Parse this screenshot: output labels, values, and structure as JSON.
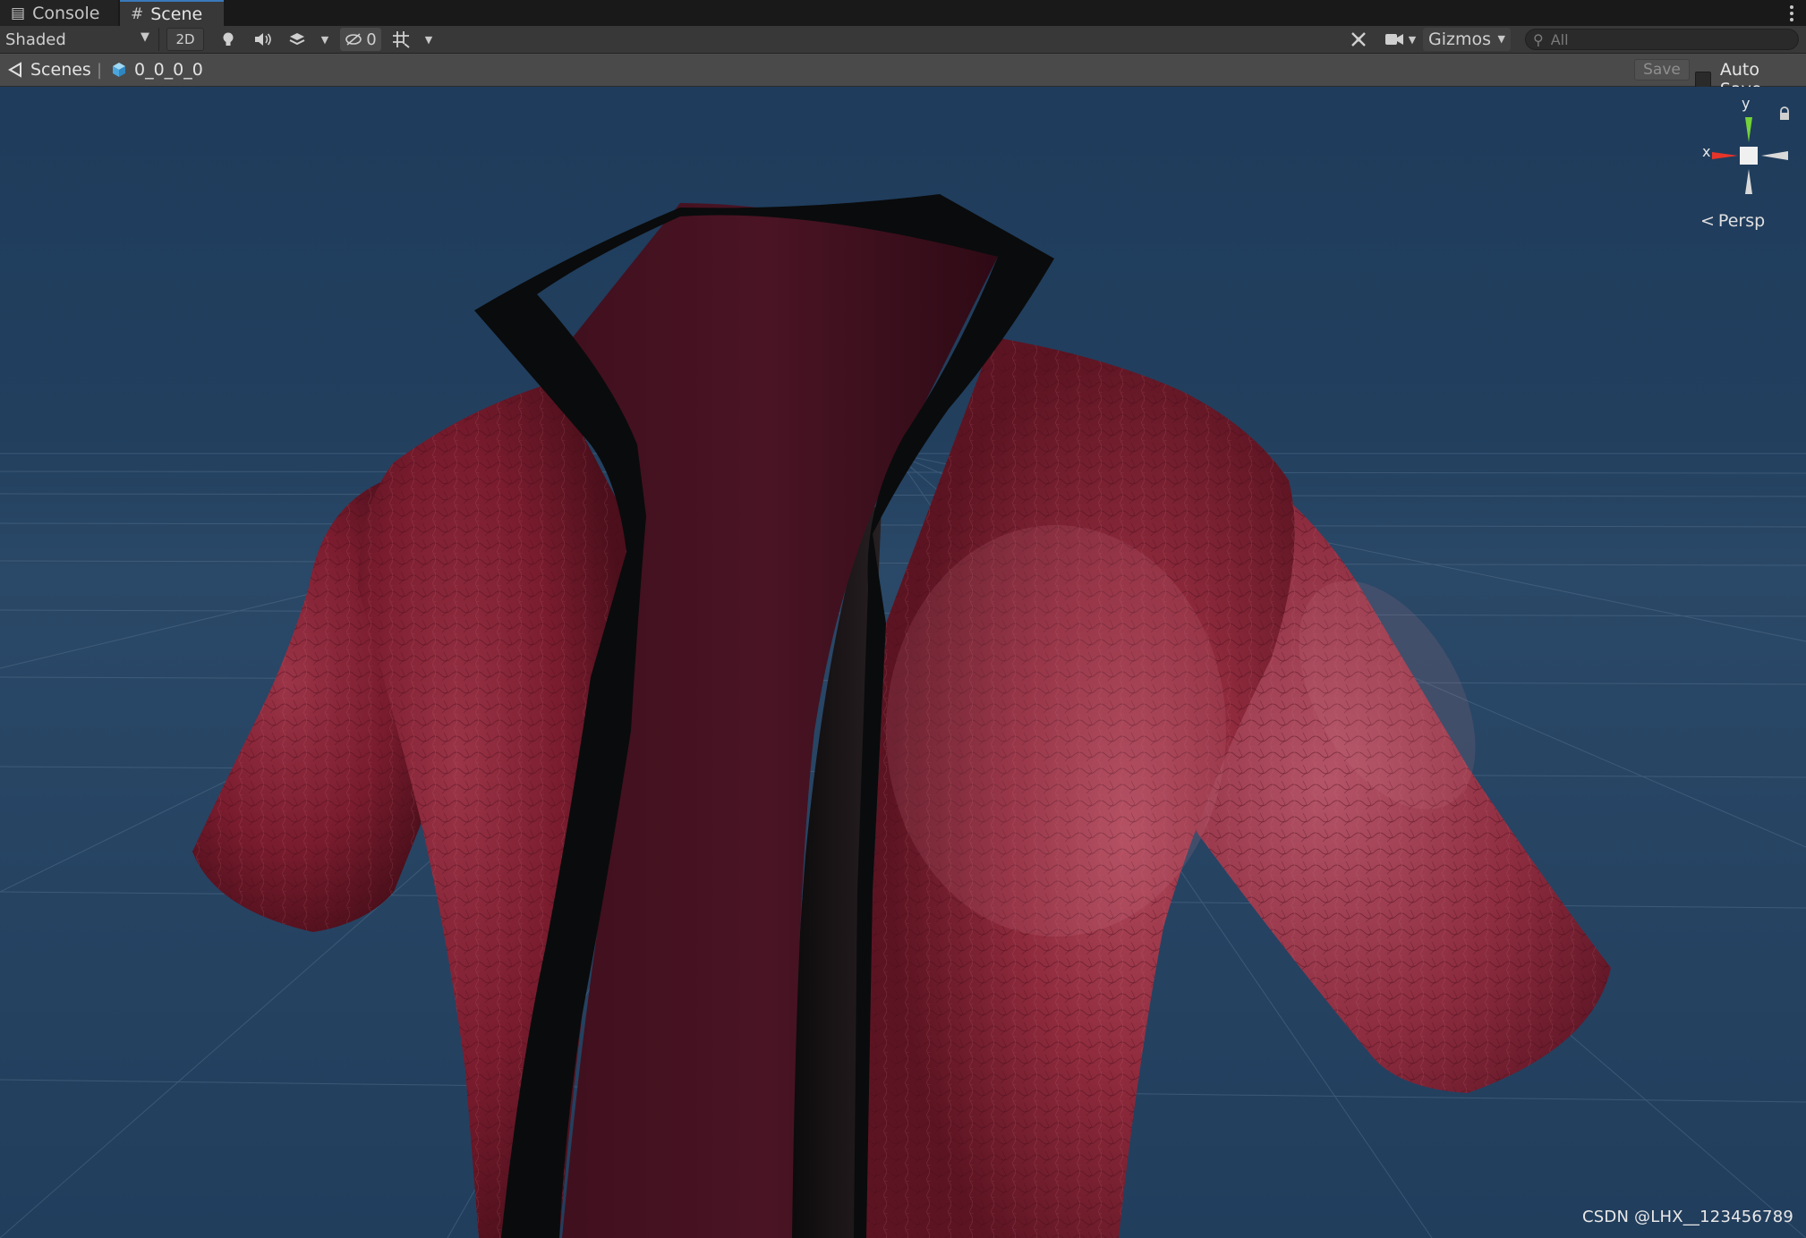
{
  "tabs": {
    "console_label": "Console",
    "scene_label": "Scene"
  },
  "toolbar": {
    "draw_mode": "Shaded",
    "mode_2d_label": "2D",
    "hidden_count": "0",
    "gizmos_label": "Gizmos",
    "search_placeholder": "All"
  },
  "breadcrumb": {
    "scenes_label": "Scenes",
    "object_name": "0_0_0_0"
  },
  "scene_actions": {
    "save_label": "Save",
    "auto_save_label": "Auto Save"
  },
  "orientation_gizmo": {
    "y_label": "y",
    "x_label": "x",
    "projection_label": "Persp"
  },
  "watermark": "CSDN @LHX__123456789",
  "colors": {
    "viewport_background": "#203a58",
    "jacket_outer": "#8a1f30",
    "jacket_lining": "#3c0f1c",
    "collar_trim": "#0a0b0c",
    "axis_x": "#e8352a",
    "axis_y": "#74d23a"
  },
  "icons": {
    "console": "console-icon",
    "scene": "scene-hash-icon",
    "lighting": "lightbulb-icon",
    "audio": "speaker-icon",
    "effects": "layers-icon",
    "visibility": "eye-slash-icon",
    "grid": "grid-icon",
    "tools": "tools-icon",
    "camera": "camera-icon",
    "search": "search-icon",
    "back": "scenes-back-icon",
    "prefab": "cube-icon",
    "lock": "lock-icon"
  }
}
